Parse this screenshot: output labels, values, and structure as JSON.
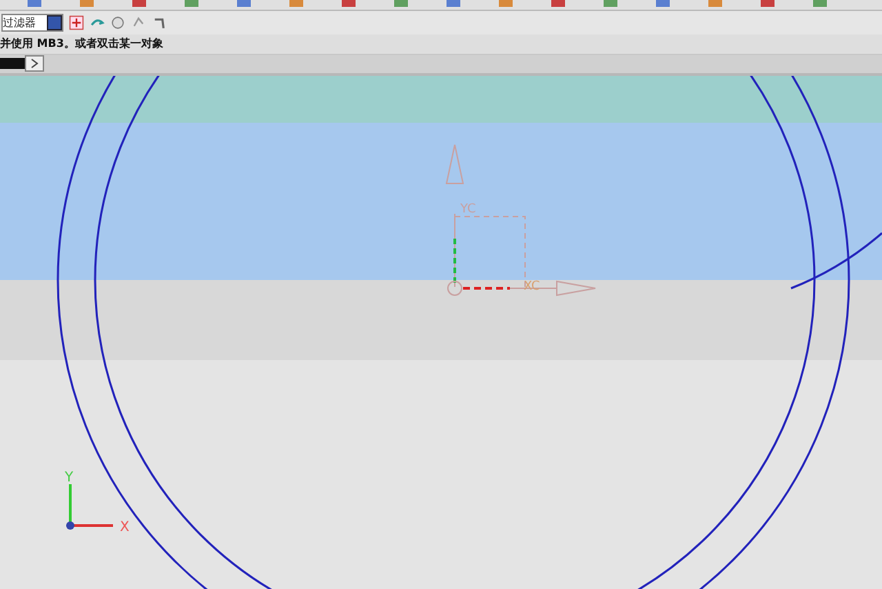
{
  "toolbar": {
    "filter": {
      "value": "过滤器"
    }
  },
  "prompt": {
    "text": "并使用 MB3。或者双击某一对象"
  },
  "viewport": {
    "wcs": {
      "x_label": "XC",
      "y_label": "YC"
    },
    "triad": {
      "x_label": "X",
      "y_label": "Y"
    }
  }
}
